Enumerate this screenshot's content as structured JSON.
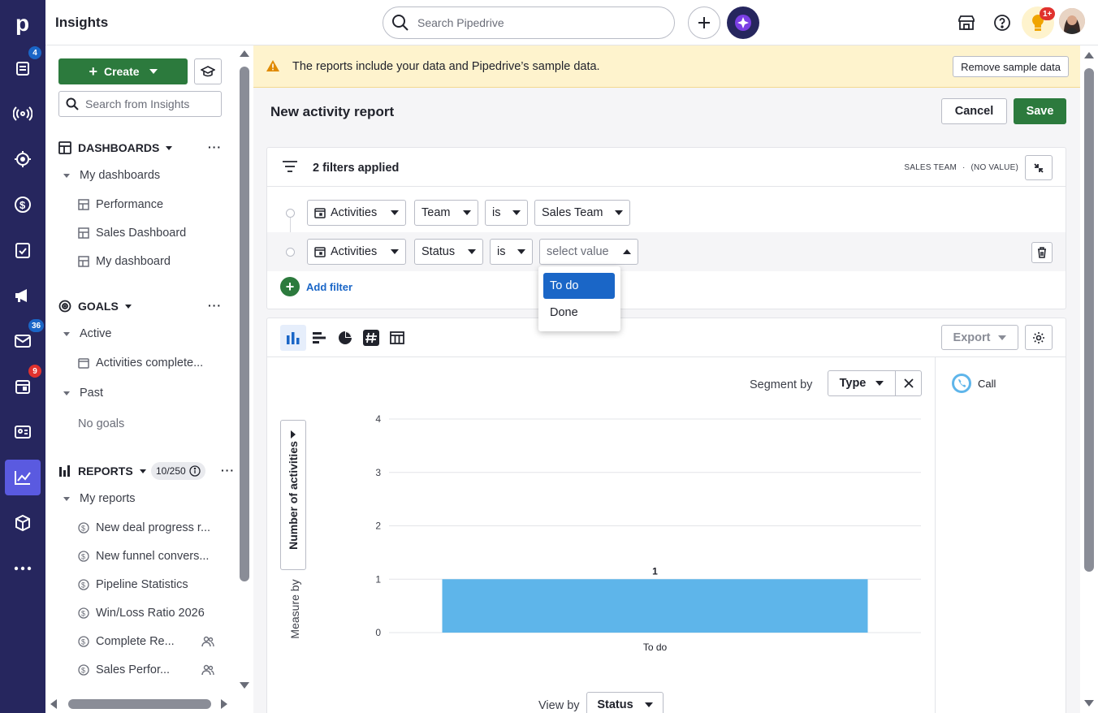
{
  "app": {
    "title": "Insights"
  },
  "topbar": {
    "search_placeholder": "Search Pipedrive",
    "notification_badge": "1+"
  },
  "rail": {
    "badges": {
      "leads": "4",
      "mail": "36",
      "calendar": "9"
    },
    "colors": {
      "bg": "#26265e",
      "active": "#5a5ae0",
      "badge_blue": "#1a66c7",
      "badge_red": "#e0322e"
    }
  },
  "sidebar": {
    "create_label": "Create",
    "search_placeholder": "Search from Insights",
    "dashboards": {
      "title": "DASHBOARDS",
      "group": "My dashboards",
      "items": [
        "Performance",
        "Sales Dashboard",
        "My dashboard"
      ]
    },
    "goals": {
      "title": "GOALS",
      "active_label": "Active",
      "active_items": [
        "Activities complete..."
      ],
      "past_label": "Past",
      "past_empty": "No goals"
    },
    "reports": {
      "title": "REPORTS",
      "count": "10/250",
      "group": "My reports",
      "items": [
        {
          "label": "New deal progress r...",
          "shared": false
        },
        {
          "label": "New funnel convers...",
          "shared": false
        },
        {
          "label": "Pipeline Statistics",
          "shared": false
        },
        {
          "label": "Win/Loss Ratio 2026",
          "shared": false
        },
        {
          "label": "Complete Re...",
          "shared": true
        },
        {
          "label": "Sales Perfor...",
          "shared": true
        }
      ]
    }
  },
  "banner": {
    "text": "The reports include your data and Pipedrive’s sample data.",
    "remove_label": "Remove sample data"
  },
  "report": {
    "title": "New activity report",
    "cancel_label": "Cancel",
    "save_label": "Save"
  },
  "filters": {
    "count_label": "2 filters applied",
    "summary_team": "SALES TEAM",
    "summary_sep": "·",
    "summary_value": "(NO VALUE)",
    "rows": [
      {
        "entity": "Activities",
        "field": "Team",
        "operator": "is",
        "value": "Sales Team"
      },
      {
        "entity": "Activities",
        "field": "Status",
        "operator": "is",
        "value": "select value"
      }
    ],
    "add_label": "Add filter",
    "dropdown_options": [
      "To do",
      "Done"
    ],
    "dropdown_selected": "To do"
  },
  "chart_controls": {
    "export_label": "Export",
    "segment_label": "Segment by",
    "segment_value": "Type",
    "measure_label": "Measure by",
    "measure_value": "Number of activities",
    "view_label": "View by",
    "view_value": "Status",
    "legend": [
      {
        "name": "Call",
        "color": "#5eb5ea"
      }
    ]
  },
  "chart_data": {
    "type": "bar",
    "categories": [
      "To do"
    ],
    "series": [
      {
        "name": "Call",
        "values": [
          1
        ]
      }
    ],
    "ylim": [
      0,
      4
    ],
    "yticks": [
      0,
      1,
      2,
      3,
      4
    ],
    "data_labels": [
      "1"
    ],
    "ylabel": "",
    "xlabel": "",
    "grid": true,
    "bar_color": "#5eb5ea"
  }
}
